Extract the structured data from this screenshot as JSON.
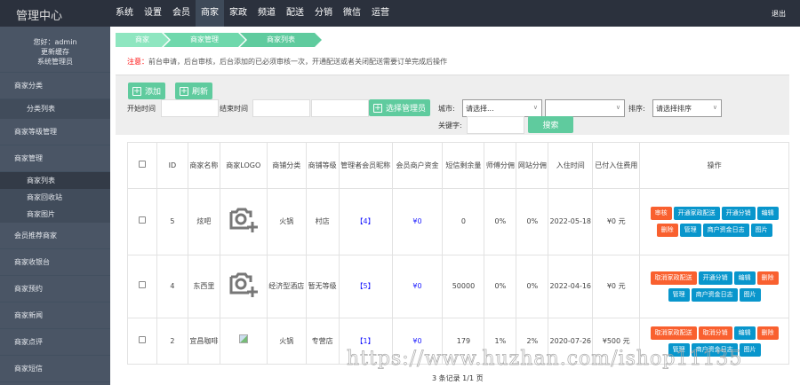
{
  "header": {
    "logo": "管理中心",
    "nav": [
      "系统",
      "设置",
      "会员",
      "商家",
      "家政",
      "频道",
      "配送",
      "分销",
      "微信",
      "运营"
    ],
    "active_nav": 3,
    "logout": "退出"
  },
  "sidebar": {
    "greeting": "您好：admin",
    "refresh_cache": "更新缓存",
    "role": "系统管理员",
    "groups": [
      {
        "label": "商家分类",
        "sub": [
          "分类列表"
        ]
      },
      {
        "label": "商家等级管理",
        "sub": []
      },
      {
        "label": "商家管理",
        "sub": [
          "商家列表",
          "商家回收站",
          "商家图片"
        ]
      },
      {
        "label": "会员推荐商家",
        "sub": []
      },
      {
        "label": "商家收银台",
        "sub": []
      },
      {
        "label": "商家预约",
        "sub": []
      },
      {
        "label": "商家新闻",
        "sub": []
      },
      {
        "label": "商家点评",
        "sub": []
      },
      {
        "label": "商家短信",
        "sub": []
      }
    ]
  },
  "breadcrumb": [
    "商家",
    "商家管理",
    "商家列表"
  ],
  "notice": {
    "label": "注意：",
    "text": "前台申请，后台审核，后台添加的已必须审核一次，开通配送或者关闭配送需要订单完成后操作"
  },
  "filters": {
    "add": "添加",
    "refresh": "刷新",
    "start_time": "开始时间",
    "end_time": "结束时间",
    "choose_admin": "选择管理员",
    "city": "城市:",
    "city_placeholder": "请选择...",
    "sort": "排序:",
    "sort_placeholder": "请选择排序",
    "keyword": "关键字:",
    "search": "搜索"
  },
  "table": {
    "headers": [
      "ID",
      "商家名称",
      "商家LOGO",
      "商铺分类",
      "商铺等级",
      "管理者会员昵称",
      "会员商户资金",
      "短信剩余量",
      "师傅分佣",
      "网站分佣",
      "入住时间",
      "已付入住费用",
      "操作"
    ],
    "rows": [
      {
        "id": "5",
        "name": "炫吧",
        "category": "火锅",
        "level": "村店",
        "admin": "【4】",
        "funds": "¥0",
        "sms": "0",
        "master": "0%",
        "site": "0%",
        "date": "2022-05-18",
        "fee": "¥0 元",
        "ops": [
          [
            "审核",
            "o"
          ],
          [
            "开通家政配送",
            "b"
          ],
          [
            "开通分销",
            "b"
          ],
          [
            "编辑",
            "b"
          ],
          [
            "删除",
            "o"
          ],
          [
            "管理",
            "b"
          ],
          [
            "商户资金日志",
            "b"
          ],
          [
            "图片",
            "b"
          ]
        ]
      },
      {
        "id": "4",
        "name": "东西里",
        "category": "经济型酒店",
        "level": "暂无等级",
        "admin": "【5】",
        "funds": "¥0",
        "sms": "50000",
        "master": "0%",
        "site": "0%",
        "date": "2022-04-16",
        "fee": "¥0 元",
        "ops": [
          [
            "取消家政配送",
            "o"
          ],
          [
            "开通分销",
            "b"
          ],
          [
            "编辑",
            "b"
          ],
          [
            "删除",
            "o"
          ],
          [
            "管理",
            "b"
          ],
          [
            "商户资金日志",
            "b"
          ],
          [
            "图片",
            "b"
          ]
        ]
      },
      {
        "id": "2",
        "name": "宜昌咖啡",
        "category": "火锅",
        "level": "专营店",
        "admin": "【1】",
        "funds": "¥0",
        "sms": "179",
        "master": "1%",
        "site": "2%",
        "date": "2020-07-26",
        "fee": "¥500 元",
        "ops": [
          [
            "取消家政配送",
            "o"
          ],
          [
            "取消分销",
            "o"
          ],
          [
            "编辑",
            "b"
          ],
          [
            "删除",
            "o"
          ],
          [
            "管理",
            "b"
          ],
          [
            "商户资金日志",
            "b"
          ],
          [
            "图片",
            "b"
          ]
        ]
      }
    ]
  },
  "footer": "3 条记录 1/1 页",
  "watermark": "https://www.huzhan.com/ishop11135"
}
